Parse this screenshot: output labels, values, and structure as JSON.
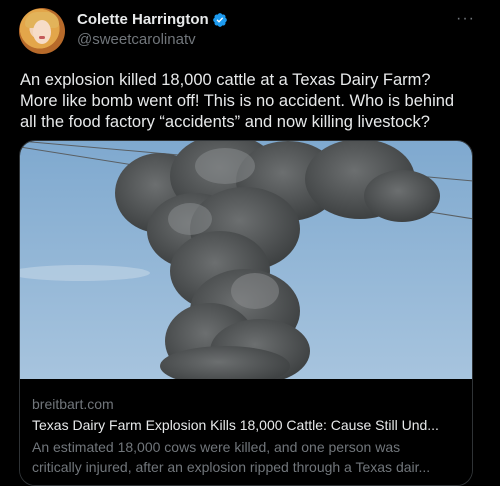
{
  "author": {
    "display_name": "Colette Harrington",
    "handle": "@sweetcarolinatv",
    "verified_icon": "verified-badge-icon",
    "accent_color": "#1d9bf0"
  },
  "more_menu": {
    "label": "···"
  },
  "tweet": {
    "lines": [
      "An explosion killed 18,000 cattle at a Texas Dairy Farm?",
      "More like bomb went off!  This is no accident. Who is behind",
      "all the food factory “accidents” and now killing livestock?"
    ]
  },
  "link_card": {
    "domain": "breitbart.com",
    "title": "Texas Dairy Farm Explosion Kills 18,000 Cattle: Cause Still Und...",
    "description_lines": [
      "An estimated 18,000 cows were killed, and one person was",
      "critically injured, after an explosion ripped through a Texas dair..."
    ]
  },
  "colors": {
    "background": "#000000",
    "text_primary": "#e7e9ea",
    "text_secondary": "#71767b",
    "border": "#2f3336",
    "sky": "#8eb6d8",
    "smoke": "#55585a"
  }
}
